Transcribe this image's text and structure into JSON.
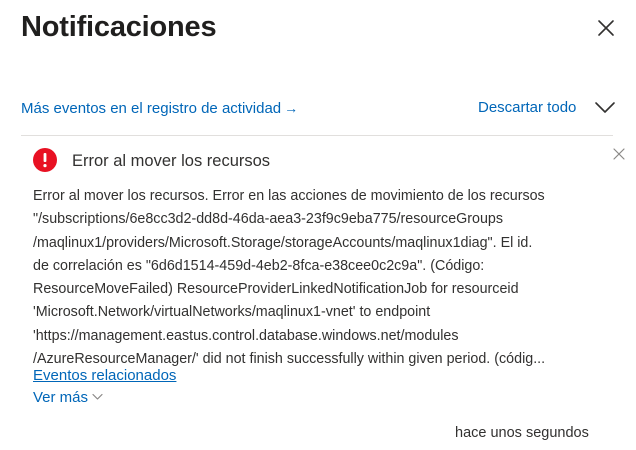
{
  "panel": {
    "title": "Notificaciones",
    "activity_link": "Más eventos en el registro de actividad",
    "activity_arrow": "→",
    "dismiss_all": "Descartar todo"
  },
  "notification": {
    "title": "Error al mover los recursos",
    "message_lines": [
      "Error al mover los recursos. Error en las acciones de movimiento de los recursos",
      "\"/subscriptions/6e8cc3d2-dd8d-46da-aea3-23f9c9eba775/resourceGroups",
      "/maqlinux1/providers/Microsoft.Storage/storageAccounts/maqlinux1diag\". El id.",
      "de correlación es \"6d6d1514-459d-4eb2-8fca-e38cee0c2c9a\". (Código:",
      "ResourceMoveFailed) ResourceProviderLinkedNotificationJob for resourceid",
      "'Microsoft.Network/virtualNetworks/maqlinux1-vnet' to endpoint",
      "'https://management.eastus.control.database.windows.net/modules",
      "/AzureResourceManager/' did not finish successfully within given period. (códig..."
    ],
    "related_link": "Eventos relacionados",
    "see_more": "Ver más",
    "timestamp": "hace unos segundos",
    "status_color": "#e81123"
  },
  "icons": {
    "close": "close-icon",
    "collapse": "chevron-down-icon",
    "error": "error-icon",
    "card_dismiss": "close-icon"
  }
}
